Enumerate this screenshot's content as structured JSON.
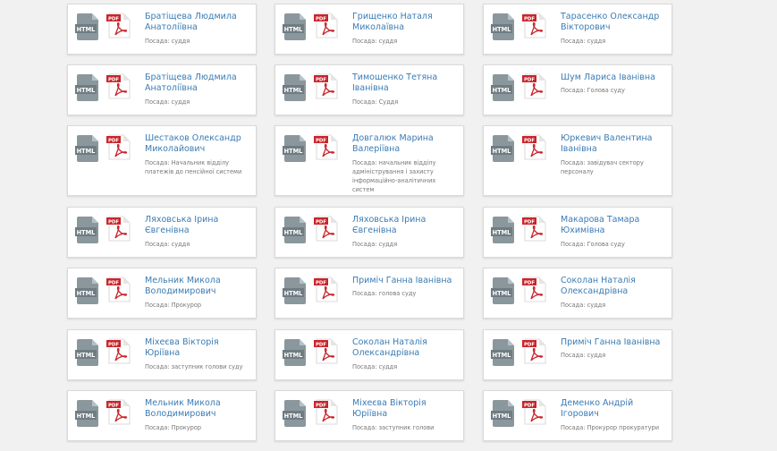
{
  "icons": {
    "html_text": "HTML",
    "pdf_text": "PDF"
  },
  "colors": {
    "link": "#3a7bb4",
    "muted": "#777777",
    "pdf_red": "#c9252b",
    "html_gray": "#7d8a90"
  },
  "cards": [
    {
      "name": "Братіщева Людмила Анатоліївна",
      "position": "Посада: суддя"
    },
    {
      "name": "Грищенко Наталя Миколаївна",
      "position": "Посада: суддя"
    },
    {
      "name": "Тарасенко Олександр Вікторович",
      "position": "Посада: суддя"
    },
    {
      "name": "Братіщева Людмила Анатоліївна",
      "position": "Посада: суддя"
    },
    {
      "name": "Тимошенко Тетяна Іванівна",
      "position": "Посада: Суддя"
    },
    {
      "name": "Шум Лариса Іванівна",
      "position": "Посада: Голова суду"
    },
    {
      "name": "Шестаков Олександр Миколайович",
      "position": "Посада: Начальник відділу платежів до пенсійної системи"
    },
    {
      "name": "Довгалюк Марина Валеріївна",
      "position": "Посада: начальник відділу адміністрування і захисту інформаційно-аналітичних систем"
    },
    {
      "name": "Юркевич Валентина Іванівна",
      "position": "Посада: завідувач сектору персоналу"
    },
    {
      "name": "Ляховська Ірина Євгенівна",
      "position": "Посада: суддя"
    },
    {
      "name": "Ляховська Ірина Євгенівна",
      "position": "Посада: суддя"
    },
    {
      "name": "Макарова Тамара Юхимівна",
      "position": "Посада: Голова суду"
    },
    {
      "name": "Мельник Микола Володимирович",
      "position": "Посада: Прокурор"
    },
    {
      "name": "Приміч Ганна Іванівна",
      "position": "Посада: голова суду"
    },
    {
      "name": "Соколан Наталія Олександрівна",
      "position": "Посада: суддя"
    },
    {
      "name": "Міхеєва Вікторія Юріївна",
      "position": "Посада: заступник голови суду"
    },
    {
      "name": "Соколан Наталія Олександрівна",
      "position": "Посада: суддя"
    },
    {
      "name": "Приміч Ганна Іванівна",
      "position": "Посада: суддя"
    },
    {
      "name": "Мельник Микола Володимирович",
      "position": "Посада: Прокурор"
    },
    {
      "name": "Міхеєва Вікторія Юріївна",
      "position": "Посада: заступник голови"
    },
    {
      "name": "Деменко Андрій Ігорович",
      "position": "Посада: Прокурор прокуратури"
    }
  ]
}
